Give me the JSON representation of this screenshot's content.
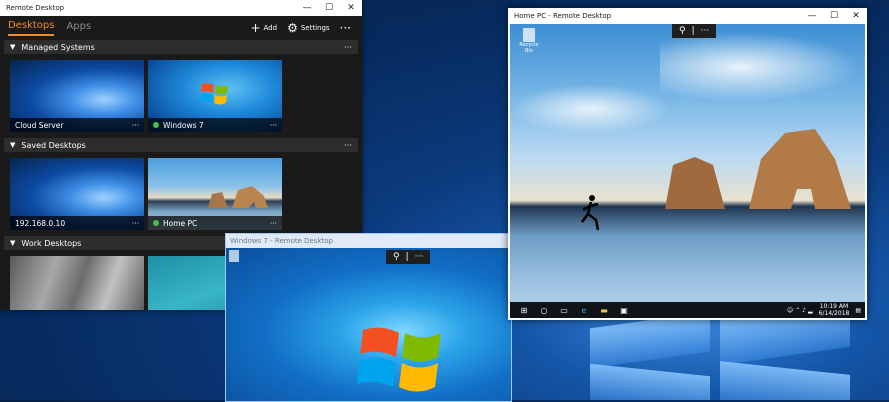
{
  "main_window": {
    "title": "Remote Desktop",
    "controls": {
      "minimize": "—",
      "maximize": "☐",
      "close": "✕"
    },
    "tabs": [
      {
        "label": "Desktops"
      },
      {
        "label": "Apps"
      }
    ],
    "actions": {
      "add_label": "Add",
      "settings_label": "Settings",
      "more": "···"
    },
    "groups": [
      {
        "title": "Managed Systems",
        "tiles": [
          {
            "name": "Cloud Server",
            "connected": false
          },
          {
            "name": "Windows 7",
            "connected": true
          }
        ]
      },
      {
        "title": "Saved Desktops",
        "tiles": [
          {
            "name": "192.168.0.10",
            "connected": false
          },
          {
            "name": "Home PC",
            "connected": true
          }
        ]
      },
      {
        "title": "Work Desktops",
        "tiles": []
      }
    ],
    "accent_color": "#f08a24"
  },
  "win7_window": {
    "title": "Windows 7 - Remote Desktop",
    "zoom_icon": "zoom-icon",
    "more": "···"
  },
  "homepc_window": {
    "title": "Home PC - Remote Desktop",
    "controls": {
      "minimize": "—",
      "maximize": "☐",
      "close": "✕"
    },
    "desktop_icon_label": "Recycle Bin",
    "more": "···",
    "taskbar": {
      "time": "10:19 AM",
      "date": "6/14/2018"
    }
  }
}
